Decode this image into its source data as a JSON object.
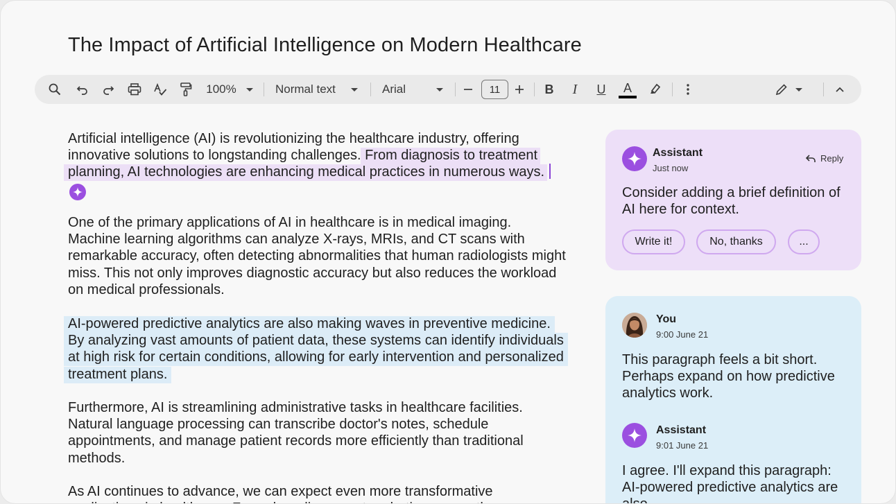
{
  "document": {
    "title": "The Impact of Artificial Intelligence on Modern Healthcare",
    "paragraphs": {
      "p1_plain": "Artificial intelligence (AI) is revolutionizing the healthcare industry, offering innovative solutions to longstanding challenges. ",
      "p1_highlight": "From diagnosis to treatment planning, AI technologies are enhancing medical practices in numerous ways.",
      "p2": "One of the primary applications of AI in healthcare is in medical imaging. Machine learning algorithms can analyze X-rays, MRIs, and CT scans with remarkable accuracy, often detecting abnormalities that human radiologists might miss. This not only improves diagnostic accuracy but also reduces the workload on medical professionals.",
      "p3_highlight": "AI-powered predictive analytics are also making waves in preventive medicine. By analyzing vast amounts of patient data, these systems can identify individuals at high risk for certain conditions, allowing for early intervention and personalized treatment plans.",
      "p4": "Furthermore, AI is streamlining administrative tasks in healthcare facilities. Natural language processing can transcribe doctor's notes, schedule appointments, and manage patient records more efficiently than traditional methods.",
      "p5": "As AI continues to advance, we can expect even more transformative applications in healthcare. From drug discovery to robotic surgery, the"
    }
  },
  "toolbar": {
    "zoom": "100%",
    "style": "Normal text",
    "font": "Arial",
    "font_size": "11",
    "icons": [
      "search-icon",
      "undo-icon",
      "redo-icon",
      "print-icon",
      "spellcheck-icon",
      "paint-format-icon",
      "decrease-size-icon",
      "increase-size-icon",
      "bold-icon",
      "italic-icon",
      "underline-icon",
      "text-color-icon",
      "highlight-icon",
      "more-icon",
      "edit-mode-icon",
      "collapse-icon"
    ],
    "text_color": "#000000"
  },
  "comments": {
    "suggestion": {
      "author": "Assistant",
      "time": "Just now",
      "reply_label": "Reply",
      "text": "Consider adding a brief definition of AI here for context.",
      "actions": [
        "Write it!",
        "No, thanks",
        "..."
      ]
    },
    "thread": [
      {
        "author": "You",
        "time": "9:00 June 21",
        "text": "This paragraph feels a bit short. Perhaps expand on how predictive analytics work."
      },
      {
        "author": "Assistant",
        "time": "9:01 June 21",
        "text": "I agree. I'll expand this paragraph: AI-powered predictive analytics are also"
      }
    ]
  },
  "colors": {
    "accent_purple": "#9b4fe0",
    "highlight_purple": "#ecdff6",
    "highlight_blue": "#dcecf7"
  }
}
